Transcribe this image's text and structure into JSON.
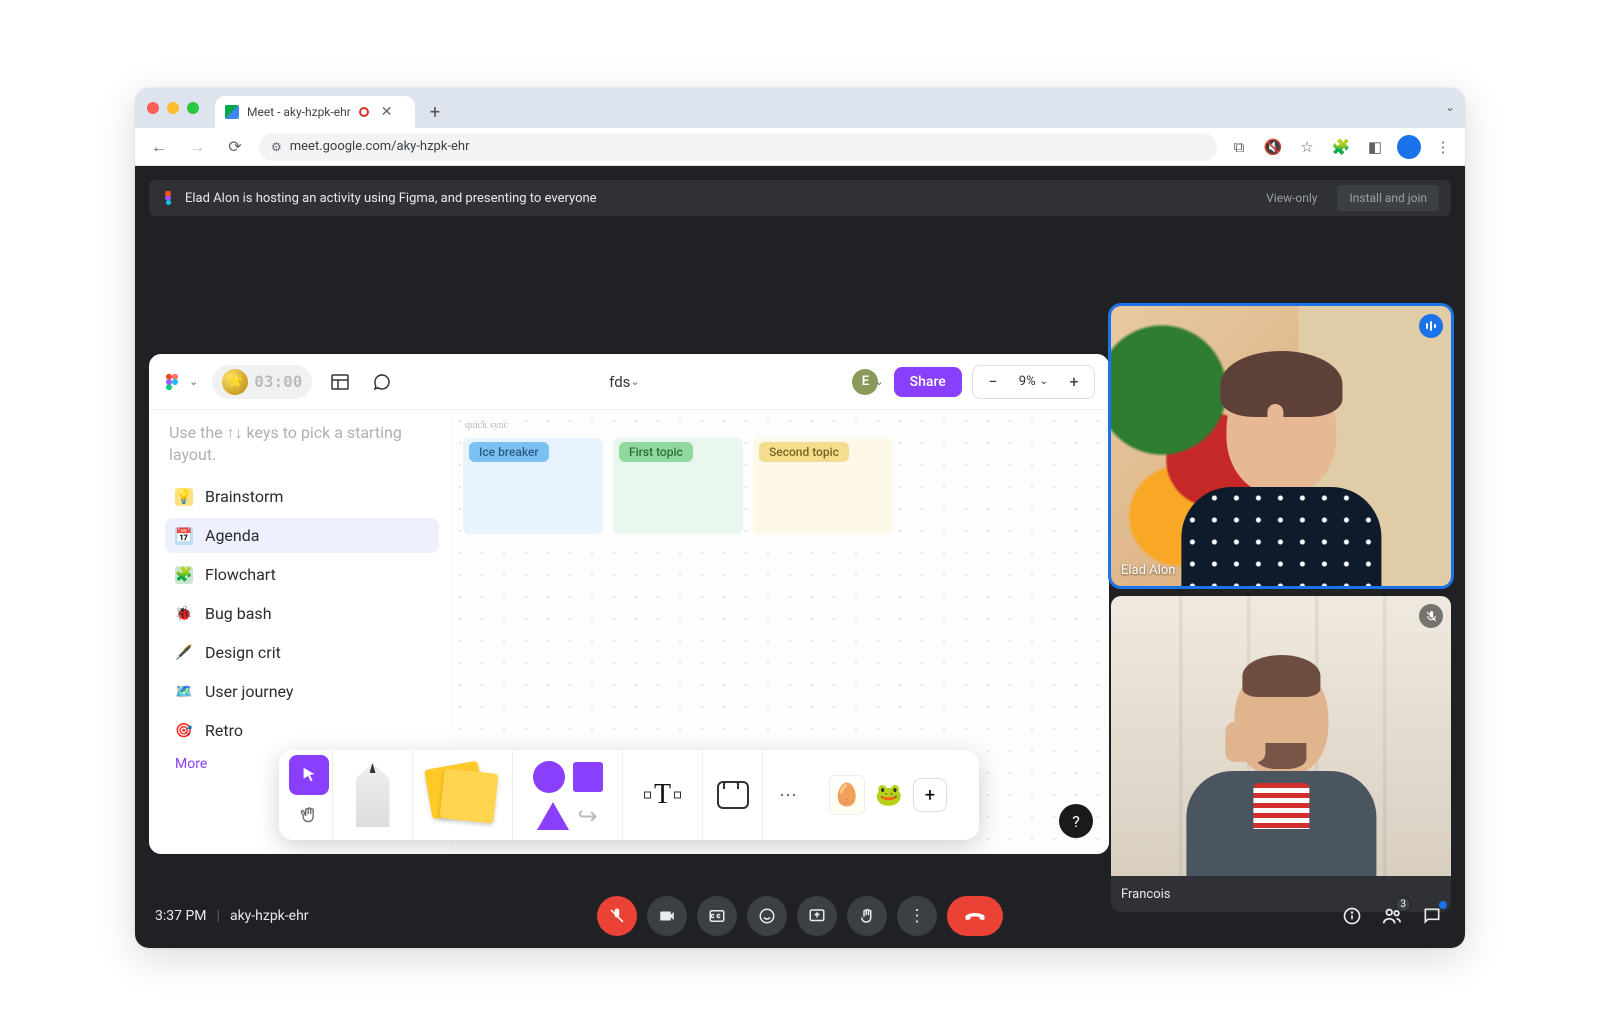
{
  "browser": {
    "tab_title": "Meet - aky-hzpk-ehr",
    "url": "meet.google.com/aky-hzpk-ehr"
  },
  "banner": {
    "text": "Elad Alon is hosting an activity using Figma, and presenting to everyone",
    "view_only": "View-only",
    "install": "Install and join"
  },
  "figma": {
    "timer": "03:00",
    "title": "fds",
    "user_initial": "E",
    "share": "Share",
    "zoom": "9%",
    "hint": "Use the ↑↓ keys to pick a starting layout.",
    "templates": [
      {
        "icon": "💡",
        "label": "Brainstorm",
        "color": "#f6b73c"
      },
      {
        "icon": "📅",
        "label": "Agenda",
        "color": "#4f8ef7",
        "selected": true
      },
      {
        "icon": "🔀",
        "label": "Flowchart",
        "color": "#34a853"
      },
      {
        "icon": "🐞",
        "label": "Bug bash",
        "color": "#ea4335"
      },
      {
        "icon": "✒️",
        "label": "Design crit",
        "color": "#8a3ffc"
      },
      {
        "icon": "🗺️",
        "label": "User journey",
        "color": "#3f51b5"
      },
      {
        "icon": "🎯",
        "label": "Retro",
        "color": "#26a69a"
      }
    ],
    "more": "More",
    "canvas_label": "quick sync",
    "lanes": [
      "Ice breaker",
      "First topic",
      "Second topic"
    ]
  },
  "participants": [
    {
      "name": "Elad Alon",
      "speaking": true,
      "muted": false
    },
    {
      "name": "Francois",
      "speaking": false,
      "muted": true
    }
  ],
  "bottom": {
    "time": "3:37 PM",
    "code": "aky-hzpk-ehr",
    "people_count": "3"
  }
}
